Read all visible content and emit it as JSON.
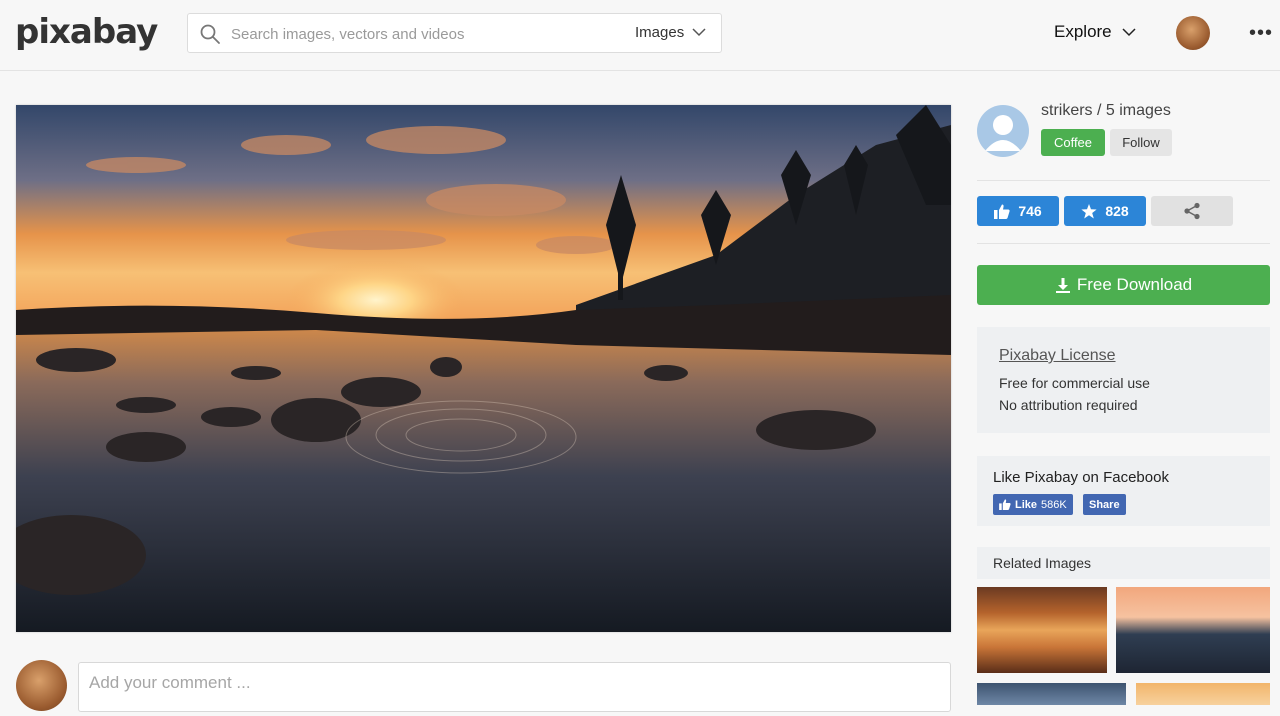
{
  "header": {
    "logo": "pixabay",
    "search_placeholder": "Search images, vectors and videos",
    "search_type": "Images",
    "explore_label": "Explore",
    "more_label": "•••"
  },
  "author": {
    "name_line": "strikers / 5 images",
    "coffee_label": "Coffee",
    "follow_label": "Follow"
  },
  "stats": {
    "likes": "746",
    "favorites": "828"
  },
  "download": {
    "label": "Free Download"
  },
  "license": {
    "title": "Pixabay License",
    "line1": "Free for commercial use",
    "line2": "No attribution required"
  },
  "facebook": {
    "title": "Like Pixabay on Facebook",
    "like_label": "Like",
    "like_count": "586K",
    "share_label": "Share"
  },
  "related": {
    "title": "Related Images"
  },
  "comment": {
    "placeholder": "Add your comment ..."
  },
  "colors": {
    "accent_green": "#4caf50",
    "accent_blue": "#2c85d7",
    "facebook_blue": "#4267b2"
  }
}
